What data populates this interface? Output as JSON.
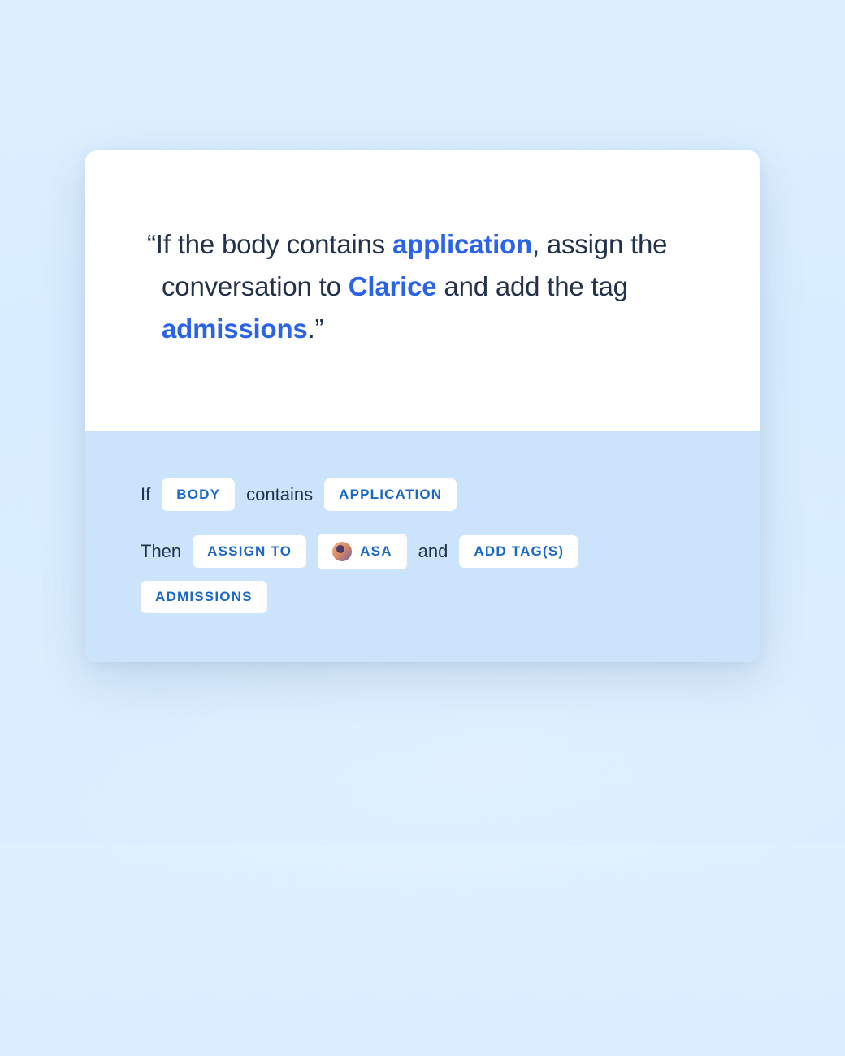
{
  "quote": {
    "open": "“",
    "text1": "If the body contains ",
    "hl1": "application",
    "text2": ", assign the conversation to ",
    "hl2": "Clarice",
    "text3": " and add the tag ",
    "hl3": "admissions",
    "text4": ".",
    "close": "”"
  },
  "rule": {
    "if_label": "If",
    "then_label": "Then",
    "contains_label": "contains",
    "and_label": "and",
    "condition_field": "BODY",
    "condition_value": "APPLICATION",
    "action_assign": "ASSIGN TO",
    "assignee": "ASA",
    "action_tag": "ADD TAG(S)",
    "tag_value": "ADMISSIONS"
  }
}
